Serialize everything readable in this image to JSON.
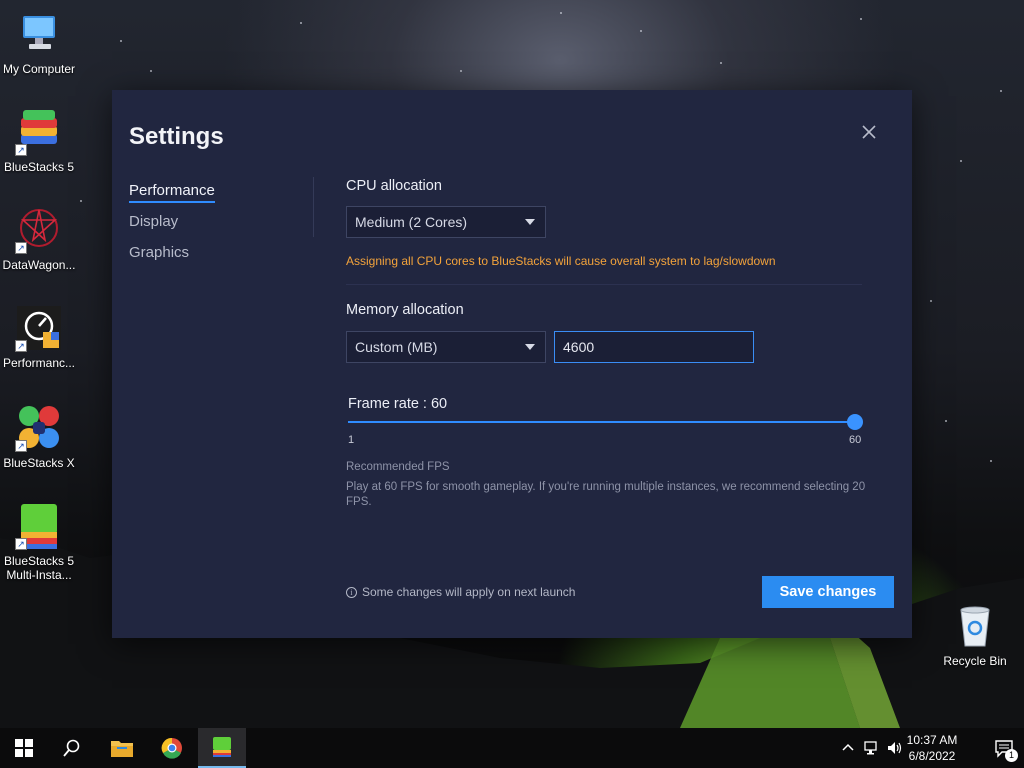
{
  "desktop": {
    "icons": [
      {
        "label": "My Computer"
      },
      {
        "label": "BlueStacks 5"
      },
      {
        "label": "DataWagon..."
      },
      {
        "label": "Performanc..."
      },
      {
        "label": "BlueStacks X"
      },
      {
        "label": "BlueStacks 5 Multi-Insta..."
      },
      {
        "label": "Recycle Bin"
      }
    ]
  },
  "dialog": {
    "title": "Settings",
    "nav": [
      {
        "label": "Performance",
        "active": true
      },
      {
        "label": "Display"
      },
      {
        "label": "Graphics"
      }
    ],
    "cpu": {
      "label": "CPU allocation",
      "selected": "Medium (2 Cores)",
      "warning": "Assigning all CPU cores to BlueStacks will cause overall system to lag/slowdown"
    },
    "memory": {
      "label": "Memory allocation",
      "selected": "Custom (MB)",
      "value": "4600"
    },
    "frame_rate": {
      "label": "Frame rate : 60",
      "min": "1",
      "max": "60",
      "value": 60,
      "recommended_title": "Recommended FPS",
      "recommended_desc": "Play at 60 FPS for smooth gameplay. If you're running multiple instances, we recommend selecting 20 FPS."
    },
    "footer": {
      "note": "Some changes will apply on next launch",
      "save_label": "Save changes"
    }
  },
  "taskbar": {
    "time": "10:37 AM",
    "date": "6/8/2022",
    "notification_count": "1"
  },
  "colors": {
    "accent": "#2b8cf1",
    "warning": "#f3a33b",
    "dialog_bg": "#212640"
  }
}
